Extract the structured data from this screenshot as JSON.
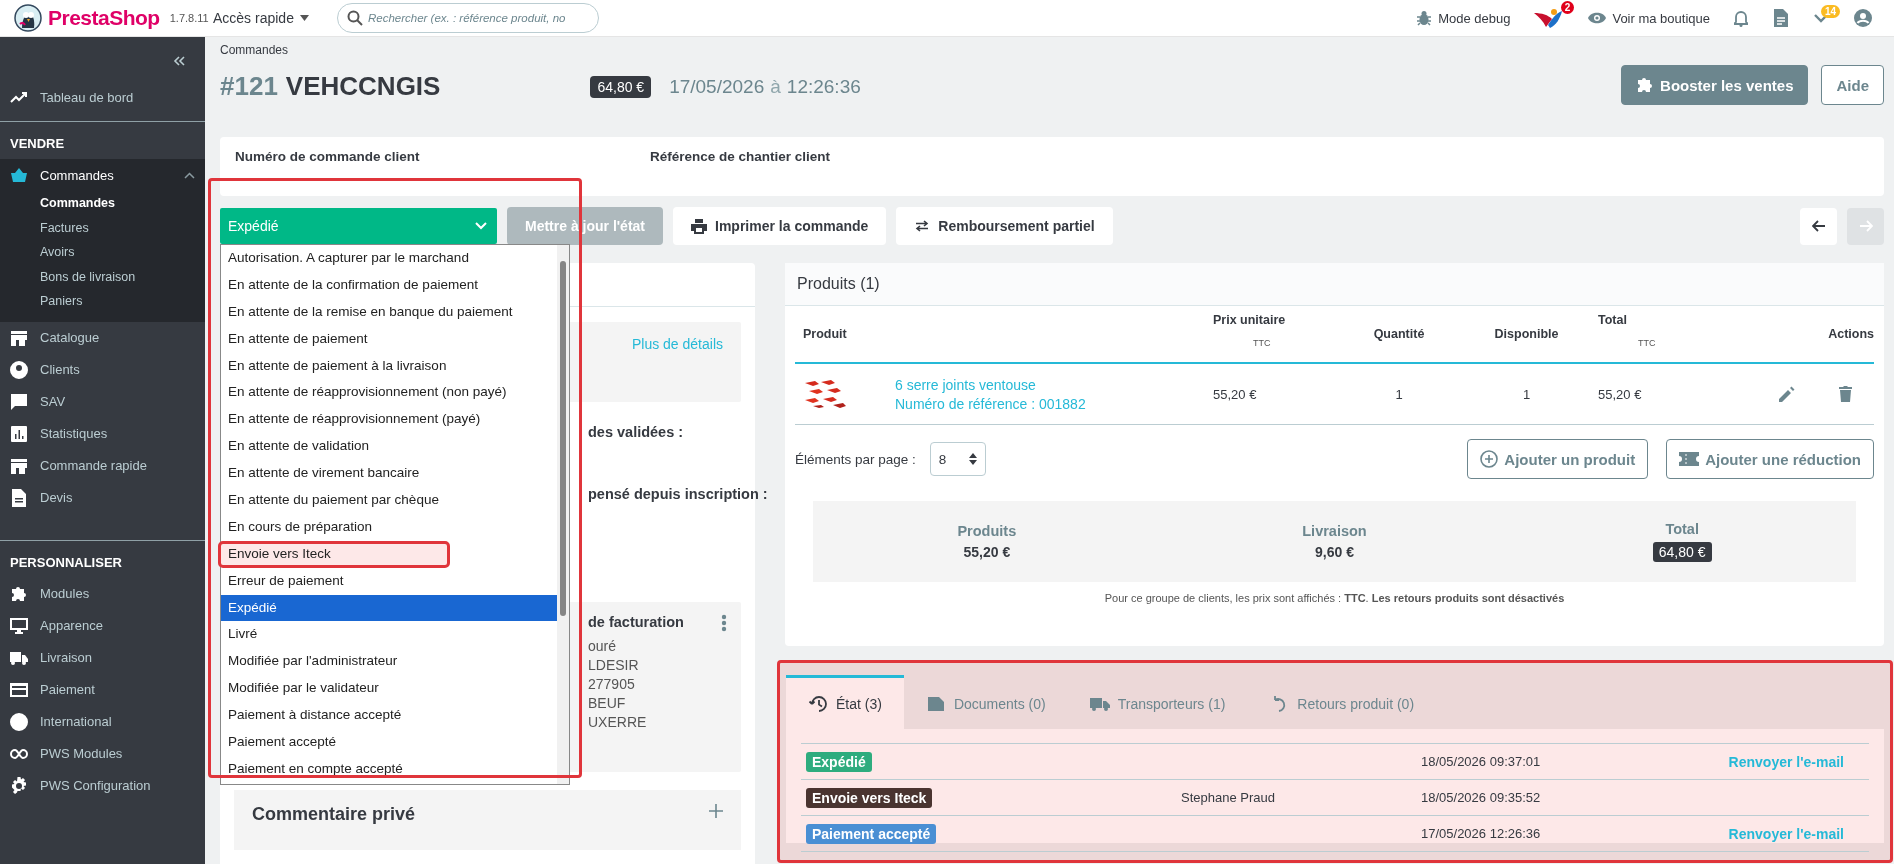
{
  "header": {
    "logo": "PrestaShop",
    "version": "1.7.8.11",
    "quick_access": "Accès rapide",
    "search": {
      "placeholder": "Rechercher (ex. : référence produit, no"
    },
    "debug": "Mode debug",
    "notification_badge": "2",
    "view_shop": "Voir ma boutique",
    "updates_badge": "14"
  },
  "sidebar": {
    "groups": [
      {
        "items": [
          {
            "label": "Tableau de bord",
            "selected": false
          }
        ]
      },
      {
        "title": "VENDRE",
        "items": [
          {
            "label": "Commandes",
            "selected": true,
            "expanded": true,
            "children": [
              {
                "label": "Commandes",
                "selected": true
              },
              {
                "label": "Factures",
                "selected": false
              },
              {
                "label": "Avoirs",
                "selected": false
              },
              {
                "label": "Bons de livraison",
                "selected": false
              },
              {
                "label": "Paniers",
                "selected": false
              }
            ]
          },
          {
            "label": "Catalogue",
            "selected": false
          },
          {
            "label": "Clients",
            "selected": false
          },
          {
            "label": "SAV",
            "selected": false
          },
          {
            "label": "Statistiques",
            "selected": false
          },
          {
            "label": "Commande rapide",
            "selected": false
          },
          {
            "label": "Devis",
            "selected": false
          }
        ]
      },
      {
        "title": "PERSONNALISER",
        "items": [
          {
            "label": "Modules",
            "selected": false
          },
          {
            "label": "Apparence",
            "selected": false
          },
          {
            "label": "Livraison",
            "selected": false
          },
          {
            "label": "Paiement",
            "selected": false
          },
          {
            "label": "International",
            "selected": false
          },
          {
            "label": "PWS Modules",
            "selected": false
          },
          {
            "label": "PWS Configuration",
            "selected": false
          }
        ]
      }
    ]
  },
  "breadcrumb": "Commandes",
  "order": {
    "number": "#121",
    "reference": "VEHCCNGIS",
    "total": "64,80 €",
    "date": "17/05/2026",
    "at": "à",
    "time": "12:26:36"
  },
  "toolbar": [
    {
      "label": "Booster les ventes",
      "kind": "primary"
    },
    {
      "label": "Aide",
      "kind": "outline"
    }
  ],
  "client_refs": [
    "Numéro de commande client",
    "Référence de chantier client"
  ],
  "status_select": {
    "value": "Expédié",
    "expanded": true,
    "annotated": true,
    "options": [
      {
        "label": "Autorisation. A capturer par le marchand",
        "selected": false,
        "annotated": false
      },
      {
        "label": "En attente de la confirmation de paiement",
        "selected": false,
        "annotated": false
      },
      {
        "label": "En attente de la remise en banque du paiement",
        "selected": false,
        "annotated": false
      },
      {
        "label": "En attente de paiement",
        "selected": false,
        "annotated": false
      },
      {
        "label": "En attente de paiement à la livraison",
        "selected": false,
        "annotated": false
      },
      {
        "label": "En attente de réapprovisionnement (non payé)",
        "selected": false,
        "annotated": false
      },
      {
        "label": "En attente de réapprovisionnement (payé)",
        "selected": false,
        "annotated": false
      },
      {
        "label": "En attente de validation",
        "selected": false,
        "annotated": false
      },
      {
        "label": "En attente de virement bancaire",
        "selected": false,
        "annotated": false
      },
      {
        "label": "En attente du paiement par chèque",
        "selected": false,
        "annotated": false
      },
      {
        "label": "En cours de préparation",
        "selected": false,
        "annotated": false
      },
      {
        "label": "Envoie vers Iteck",
        "selected": false,
        "annotated": true
      },
      {
        "label": "Erreur de paiement",
        "selected": false,
        "annotated": false
      },
      {
        "label": "Expédié",
        "selected": true,
        "annotated": false
      },
      {
        "label": "Livré",
        "selected": false,
        "annotated": false
      },
      {
        "label": "Modifiée par l'administrateur",
        "selected": false,
        "annotated": false
      },
      {
        "label": "Modifiée par le validateur",
        "selected": false,
        "annotated": false
      },
      {
        "label": "Paiement à distance accepté",
        "selected": false,
        "annotated": false
      },
      {
        "label": "Paiement accepté",
        "selected": false,
        "annotated": false
      },
      {
        "label": "Paiement en compte accepté",
        "selected": false,
        "annotated": false
      }
    ]
  },
  "actions": [
    {
      "label": "Mettre à jour l'état",
      "disabled": true
    },
    {
      "label": "Imprimer la commande",
      "disabled": false
    },
    {
      "label": "Remboursement partiel",
      "disabled": false
    }
  ],
  "pager": [
    {
      "disabled": false
    },
    {
      "disabled": true
    }
  ],
  "customer_panel": {
    "details_link": "Plus de détails",
    "fragments": [
      "des validées :",
      "pensé depuis inscription :"
    ],
    "billing": {
      "title": "de facturation",
      "lines": [
        "ouré",
        "LDESIR",
        "277905",
        "BEUF",
        "UXERRE"
      ]
    },
    "comment_title": "Commentaire privé"
  },
  "products": {
    "title": "Produits (1)",
    "columns": [
      {
        "label": "Produit"
      },
      {
        "label": "Prix unitaire",
        "sub": "TTC"
      },
      {
        "label": "Quantité"
      },
      {
        "label": "Disponible"
      },
      {
        "label": "Total",
        "sub": "TTC"
      },
      {
        "label": "Actions"
      }
    ],
    "rows": [
      {
        "name": "6 serre joints ventouse",
        "reference": "Numéro de référence : 001882",
        "price": "55,20 €",
        "quantity": "1",
        "available": "1",
        "total": "55,20 €"
      }
    ],
    "per_page_label": "Éléments par page :",
    "per_page": "8",
    "buttons": [
      "Ajouter un produit",
      "Ajouter une réduction"
    ],
    "summary": [
      {
        "label": "Produits",
        "value": "55,20 €",
        "kind": "plain"
      },
      {
        "label": "Livraison",
        "value": "9,60 €",
        "kind": "plain"
      },
      {
        "label": "Total",
        "value": "64,80 €",
        "kind": "badge"
      }
    ],
    "note": "Pour ce groupe de clients, les prix sont affichés : **TTC**. **Les retours produits sont désactivés**"
  },
  "history": {
    "annotated": true,
    "tabs": [
      {
        "label": "État (3)",
        "selected": true
      },
      {
        "label": "Documents (0)",
        "selected": false
      },
      {
        "label": "Transporteurs (1)",
        "selected": false
      },
      {
        "label": "Retours produit (0)",
        "selected": false
      }
    ],
    "rows": [
      {
        "status": "Expédié",
        "color": "#2eac7e",
        "date": "18/05/2026 09:37:01",
        "action": "Renvoyer l'e-mail"
      },
      {
        "status": "Envoie vers Iteck",
        "color": "#4a3430",
        "employee": "Stephane Praud",
        "date": "18/05/2026 09:35:52"
      },
      {
        "status": "Paiement accepté",
        "color": "#4a8fd4",
        "date": "17/05/2026 12:26:36",
        "action": "Renvoyer l'e-mail"
      }
    ]
  }
}
